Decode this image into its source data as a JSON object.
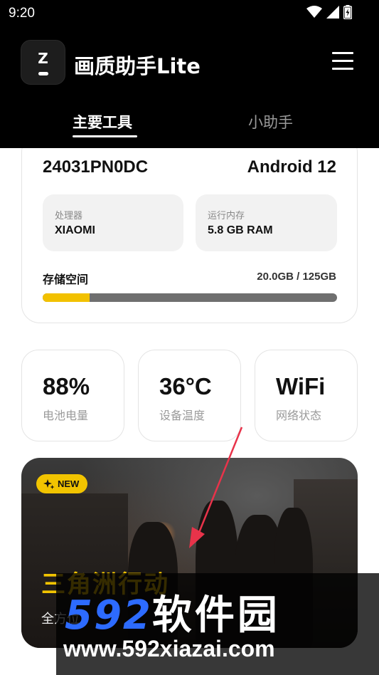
{
  "status_bar": {
    "time": "9:20"
  },
  "app": {
    "logo_letter": "Z",
    "title": "画质助手Lite"
  },
  "tabs": [
    {
      "label": "主要工具",
      "active": true
    },
    {
      "label": "小助手",
      "active": false
    }
  ],
  "device": {
    "model": "24031PN0DC",
    "android": "Android 12",
    "processor_label": "处理器",
    "processor_value": "XIAOMI",
    "ram_label": "运行内存",
    "ram_value": "5.8 GB RAM",
    "storage_label": "存储空间",
    "storage_value": "20.0GB / 125GB",
    "storage_used_fraction": 0.16
  },
  "stats": [
    {
      "value": "88%",
      "label": "电池电量"
    },
    {
      "value": "36°C",
      "label": "设备温度"
    },
    {
      "value": "WiFi",
      "label": "网络状态"
    }
  ],
  "banner": {
    "badge": "NEW",
    "title": "三角洲行动",
    "subtitle": "全方位"
  },
  "watermark": {
    "brand_digits": "592",
    "brand_text": "软件园",
    "url": "www.592xiazai.com"
  },
  "colors": {
    "accent": "#f2c400",
    "watermark_blue": "#2d6bff",
    "annotation_arrow": "#e8334a"
  },
  "icons": [
    "wifi-icon",
    "signal-icon",
    "battery-charging-icon",
    "menu-icon",
    "sparkle-icon"
  ]
}
